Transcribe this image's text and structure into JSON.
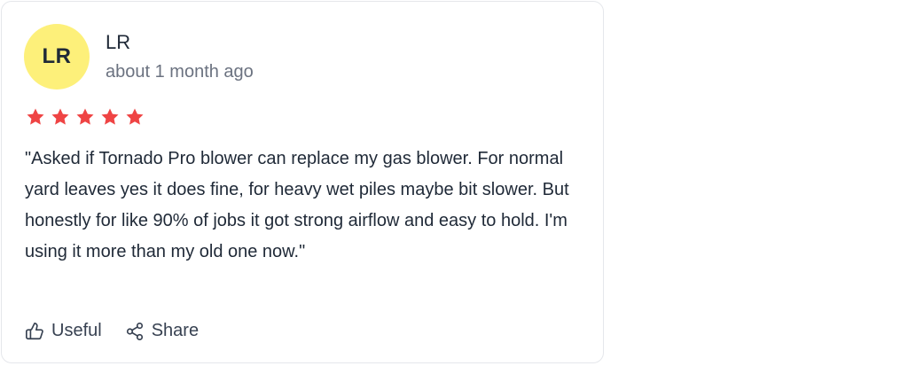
{
  "review": {
    "avatar_initials": "LR",
    "author": "LR",
    "time": "about 1 month ago",
    "rating": 5,
    "rating_max": 5,
    "star_color": "#ef4444",
    "text": "\"Asked if Tornado Pro blower can replace my gas blower. For normal yard leaves yes it does fine, for heavy wet piles maybe bit slower. But honestly for like 90% of jobs it got strong airflow and easy to hold. I'm using it more than my old one now.\""
  },
  "actions": {
    "useful_label": "Useful",
    "useful_icon": "thumbs-up-icon",
    "share_label": "Share",
    "share_icon": "share-icon"
  },
  "colors": {
    "avatar_bg": "#fdf07a",
    "text": "#1f2937",
    "muted": "#6b7280"
  }
}
